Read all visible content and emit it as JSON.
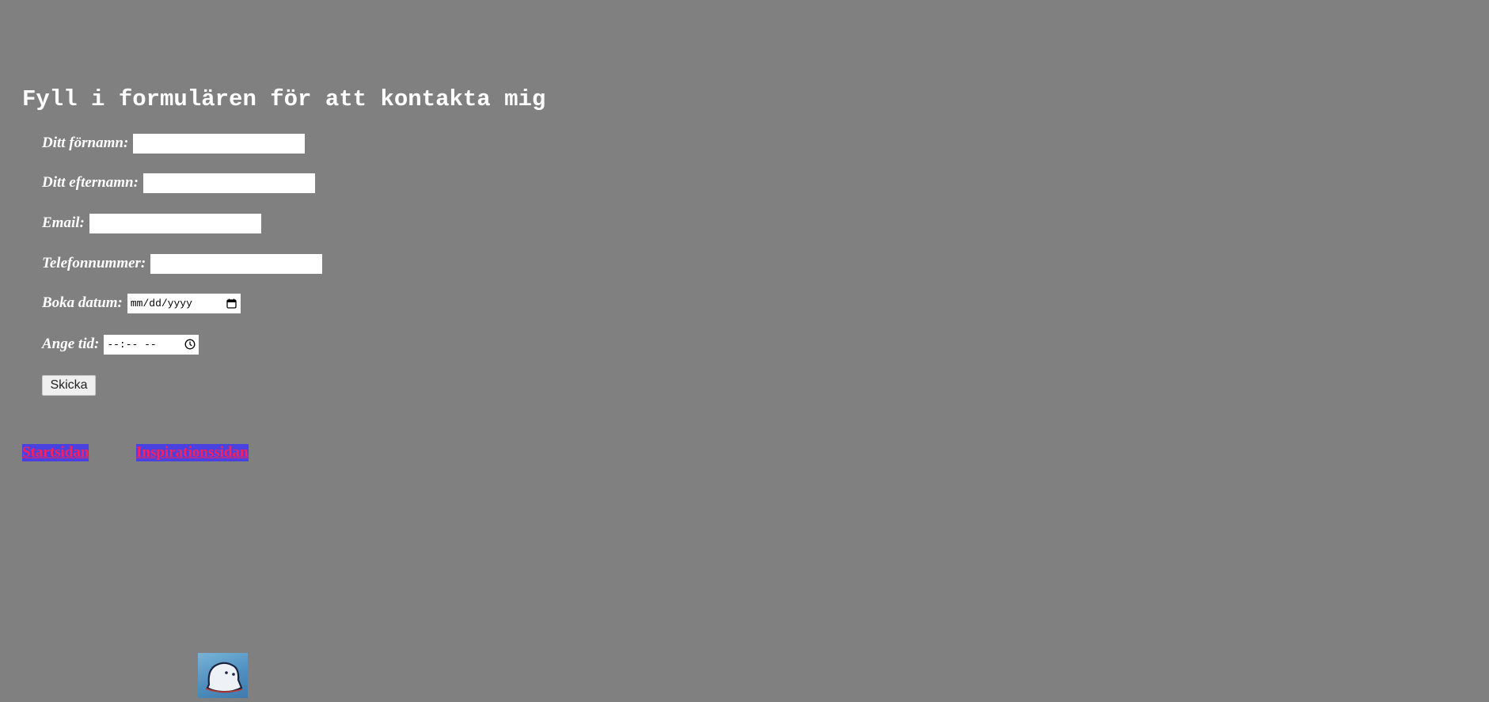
{
  "page": {
    "title": "Fyll i formulären för att kontakta mig",
    "background_color": "#808080"
  },
  "form": {
    "fields": [
      {
        "label": "Ditt förnamn:",
        "value": "",
        "type": "text"
      },
      {
        "label": "Ditt efternamn:",
        "value": "",
        "type": "text"
      },
      {
        "label": "Email:",
        "value": "",
        "type": "email"
      },
      {
        "label": "Telefonnummer:",
        "value": "",
        "type": "tel"
      },
      {
        "label": "Boka datum:",
        "value": "mm/dd/yyyy",
        "type": "date",
        "icon": "calendar-icon"
      },
      {
        "label": "Ange tid:",
        "value": "--:-- --",
        "type": "time",
        "icon": "clock-icon"
      }
    ],
    "submit_label": "Skicka"
  },
  "nav": {
    "links": [
      {
        "label": "Startsidan"
      },
      {
        "label": "Inspirationssidan"
      }
    ],
    "link_color": "#ff1f5a",
    "link_background": "#4a42e0"
  },
  "footer": {
    "logo_icon": "cartoon-ghost-icon"
  }
}
